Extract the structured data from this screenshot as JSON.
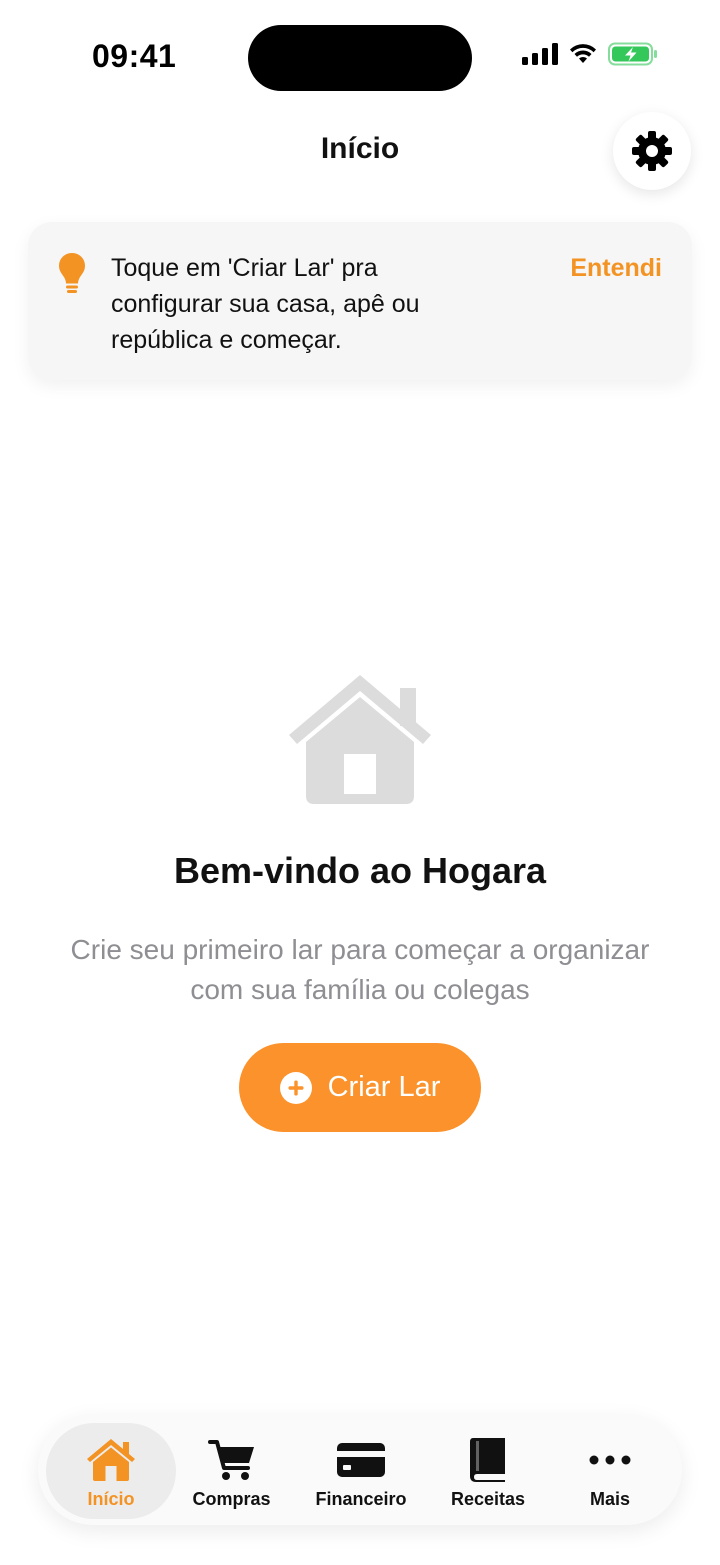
{
  "status_bar": {
    "time": "09:41",
    "icons": [
      "cellular-signal-icon",
      "wifi-icon",
      "battery-charging-icon"
    ]
  },
  "header": {
    "title": "Início",
    "settings_icon": "gear-icon"
  },
  "tip": {
    "icon": "lightbulb-icon",
    "text": "Toque em 'Criar Lar' pra configurar sua casa, apê ou república e começar.",
    "dismiss_label": "Entendi"
  },
  "empty_state": {
    "icon": "house-icon",
    "title": "Bem-vindo ao Hogara",
    "subtitle": "Crie seu primeiro lar para começar a organizar com sua família ou colegas",
    "button_label": "Criar Lar",
    "button_icon": "plus-circle-icon"
  },
  "tab_bar": {
    "tabs": [
      {
        "label": "Início",
        "icon": "house-icon",
        "active": true
      },
      {
        "label": "Compras",
        "icon": "cart-icon",
        "active": false
      },
      {
        "label": "Financeiro",
        "icon": "credit-card-icon",
        "active": false
      },
      {
        "label": "Receitas",
        "icon": "book-icon",
        "active": false
      },
      {
        "label": "Mais",
        "icon": "ellipsis-icon",
        "active": false
      }
    ]
  },
  "colors": {
    "accent": "#F39323",
    "button": "#FB922B",
    "muted_text": "#8E8E93",
    "battery_green": "#34C759",
    "placeholder_icon": "#DCDCDC"
  }
}
